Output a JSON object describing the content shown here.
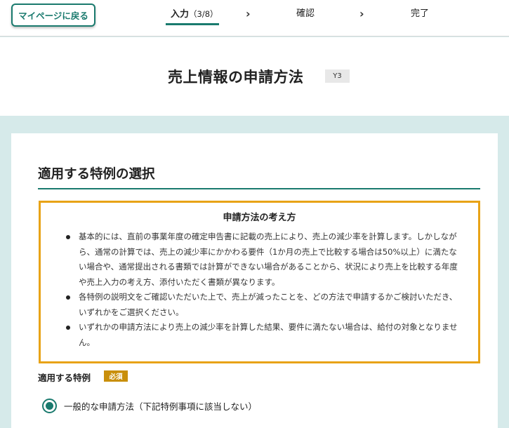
{
  "header": {
    "back_button": "マイページに戻る",
    "steps": [
      {
        "label": "入力",
        "sub": "（3/8）"
      },
      {
        "label": "確認"
      },
      {
        "label": "完了"
      }
    ]
  },
  "page": {
    "title": "売上情報の申請方法",
    "code": "Y3"
  },
  "section": {
    "title": "適用する特例の選択",
    "notice": {
      "title": "申請方法の考え方",
      "items": [
        "基本的には、直前の事業年度の確定申告書に記載の売上により、売上の減少率を計算します。しかしながら、通常の計算では、売上の減少率にかかわる要件（1か月の売上で比較する場合は50%以上）に満たない場合や、通常提出される書類では計算ができない場合があることから、状況により売上を比較する年度や売上入力の考え方、添付いただく書類が異なります。",
        "各特例の説明文をご確認いただいた上で、売上が減ったことを、どの方法で申請するかご検討いただき、いずれかをご選択ください。",
        "いずれかの申請方法により売上の減少率を計算した結果、要件に満たない場合は、給付の対象となりません。"
      ]
    },
    "field": {
      "label": "適用する特例",
      "required": "必須",
      "option_1": "一般的な申請方法（下記特例事項に該当しない）"
    }
  },
  "colors": {
    "accent": "#1a7a6e",
    "notice_border": "#e8a317",
    "required_badge": "#c98f0b",
    "background": "#d6eaea"
  }
}
